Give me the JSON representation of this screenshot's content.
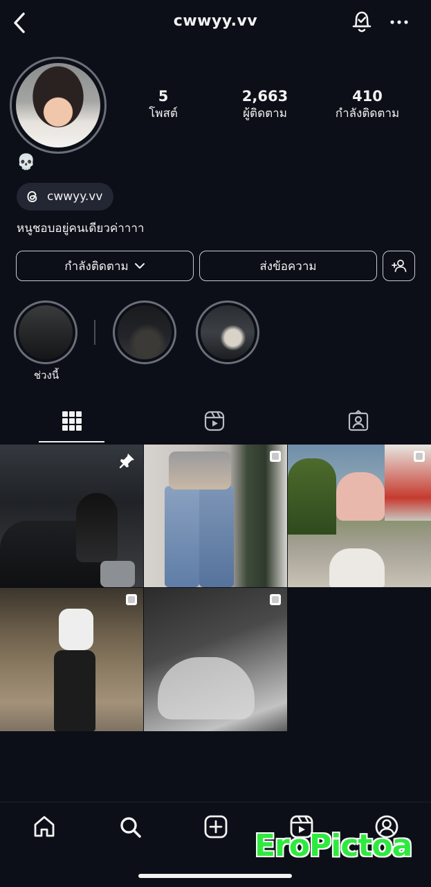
{
  "header": {
    "username": "cwwyy.vv"
  },
  "profile": {
    "stats": [
      {
        "value": "5",
        "label": "โพสต์"
      },
      {
        "value": "2,663",
        "label": "ผู้ติดตาม"
      },
      {
        "value": "410",
        "label": "กำลังติดตาม"
      }
    ],
    "emoji": "💀",
    "threads_handle": "cwwyy.vv",
    "bio": "หนูชอบอยู่คนเดียวค่าาาา"
  },
  "actions": {
    "following": "กำลังติดตาม",
    "message": "ส่งข้อความ"
  },
  "highlights": [
    {
      "label": "ช่วงนี้"
    },
    {
      "label": ""
    },
    {
      "label": ""
    }
  ],
  "watermark": "EroPictoa",
  "icons": {
    "back": "chevron-left-icon",
    "notify": "bell-check-icon",
    "more": "more-horizontal-icon",
    "threads": "threads-icon",
    "add_person": "add-person-icon",
    "tab_grid": "grid-icon",
    "tab_reels": "reels-icon",
    "tab_tagged": "tagged-icon",
    "home": "home-icon",
    "search": "search-icon",
    "create": "add-square-icon",
    "reels": "reels-icon",
    "profile": "profile-icon"
  },
  "colors": {
    "background": "#0c0f17",
    "text": "#f2f2f2",
    "ring": "#6b6f78",
    "watermark": "#2eea3f"
  }
}
